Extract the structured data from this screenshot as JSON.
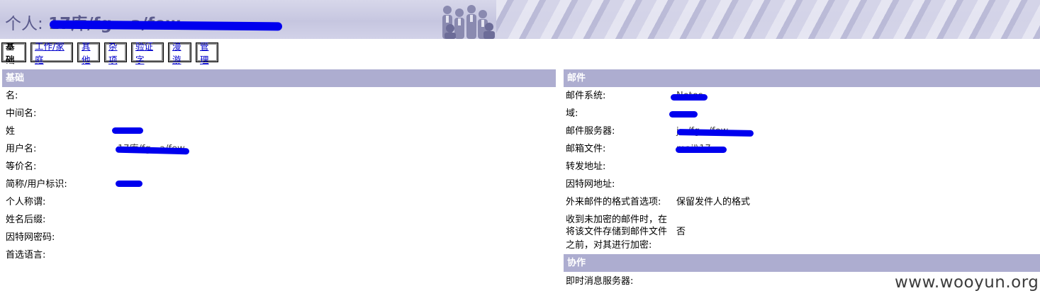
{
  "banner": {
    "prefix": "个人:",
    "name": "17库/fg...a/few"
  },
  "tabs": [
    {
      "label": "基础",
      "active": true
    },
    {
      "label": "工作/家庭",
      "active": false
    },
    {
      "label": "其他",
      "active": false
    },
    {
      "label": "杂项",
      "active": false
    },
    {
      "label": "验证字",
      "active": false
    },
    {
      "label": "漫游",
      "active": false
    },
    {
      "label": "管理",
      "active": false
    }
  ],
  "basic": {
    "title": "基础",
    "rows": [
      {
        "label": "名:",
        "value": ""
      },
      {
        "label": "中间名:",
        "value": ""
      },
      {
        "label": "姓",
        "value": ""
      },
      {
        "label": "用户名:",
        "value": "17库/fg...a/few"
      },
      {
        "label": "等价名:",
        "value": ""
      },
      {
        "label": "简称/用户标识:",
        "value": ""
      },
      {
        "label": "个人称谓:",
        "value": ""
      },
      {
        "label": "姓名后缀:",
        "value": ""
      },
      {
        "label": "因特网密码:",
        "value": ""
      },
      {
        "label": "首选语言:",
        "value": ""
      }
    ]
  },
  "mail": {
    "title": "邮件",
    "rows": [
      {
        "label": "邮件系统:",
        "value": "Notes"
      },
      {
        "label": "域:",
        "value": ""
      },
      {
        "label": "邮件服务器:",
        "value": "j.../fg.../few"
      },
      {
        "label": "邮箱文件:",
        "value": "mail\\17..."
      },
      {
        "label": "转发地址:",
        "value": ""
      },
      {
        "label": "因特网地址:",
        "value": ""
      },
      {
        "label": "外来邮件的格式首选项:",
        "value": "保留发件人的格式"
      }
    ],
    "encrypt_label_1": "收到未加密的邮件时，在",
    "encrypt_label_2": "将该文件存储到邮件文件",
    "encrypt_label_3": "之前，对其进行加密:",
    "encrypt_value": "否"
  },
  "collab": {
    "title": "协作",
    "rows": [
      {
        "label": "即时消息服务器:",
        "value": ""
      }
    ]
  },
  "watermark": "www.wooyun.org",
  "colors": {
    "section_header": "#adadd0",
    "redaction": "#0000ee",
    "link": "#0000cc"
  }
}
